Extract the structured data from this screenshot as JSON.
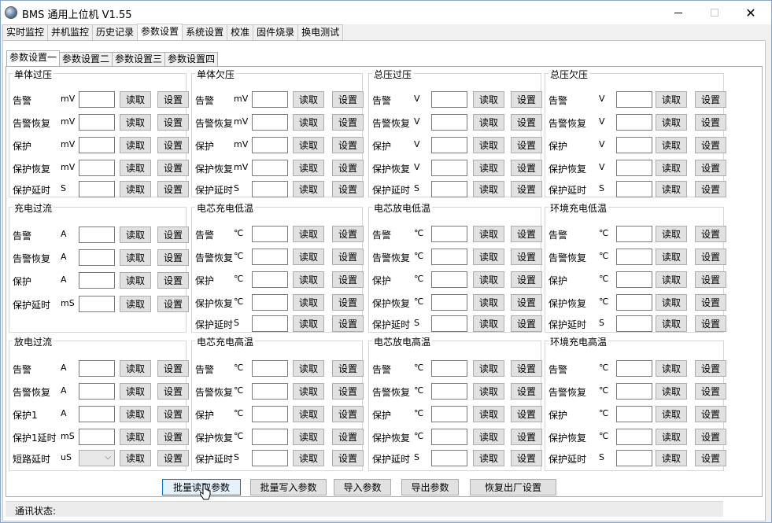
{
  "title": "BMS 通用上位机 V1.55",
  "window_buttons": {
    "minimize": "—",
    "maximize": "",
    "close": "✕"
  },
  "main_tabs": [
    "实时监控",
    "并机监控",
    "历史记录",
    "参数设置",
    "系统设置",
    "校准",
    "固件烧录",
    "换电测试"
  ],
  "main_tab_active": "参数设置",
  "sub_tabs": [
    "参数设置一",
    "参数设置二",
    "参数设置三",
    "参数设置四"
  ],
  "sub_tab_active": "参数设置一",
  "read_label": "读取",
  "set_label": "设置",
  "groups": [
    {
      "title": "单体过压",
      "rows": [
        {
          "label": "告警",
          "unit": "mV"
        },
        {
          "label": "告警恢复",
          "unit": "mV"
        },
        {
          "label": "保护",
          "unit": "mV"
        },
        {
          "label": "保护恢复",
          "unit": "mV"
        },
        {
          "label": "保护延时",
          "unit": "S"
        }
      ]
    },
    {
      "title": "单体欠压",
      "rows": [
        {
          "label": "告警",
          "unit": "mV"
        },
        {
          "label": "告警恢复",
          "unit": "mV"
        },
        {
          "label": "保护",
          "unit": "mV"
        },
        {
          "label": "保护恢复",
          "unit": "mV"
        },
        {
          "label": "保护延时",
          "unit": "S"
        }
      ]
    },
    {
      "title": "总压过压",
      "rows": [
        {
          "label": "告警",
          "unit": "V"
        },
        {
          "label": "告警恢复",
          "unit": "V"
        },
        {
          "label": "保护",
          "unit": "V"
        },
        {
          "label": "保护恢复",
          "unit": "V"
        },
        {
          "label": "保护延时",
          "unit": "S"
        }
      ]
    },
    {
      "title": "总压欠压",
      "rows": [
        {
          "label": "告警",
          "unit": "V"
        },
        {
          "label": "告警恢复",
          "unit": "V"
        },
        {
          "label": "保护",
          "unit": "V"
        },
        {
          "label": "保护恢复",
          "unit": "V"
        },
        {
          "label": "保护延时",
          "unit": "S"
        }
      ]
    },
    {
      "title": "充电过流",
      "rows": [
        {
          "label": "告警",
          "unit": "A"
        },
        {
          "label": "告警恢复",
          "unit": "A"
        },
        {
          "label": "保护",
          "unit": "A"
        },
        {
          "label": "保护延时",
          "unit": "mS"
        }
      ]
    },
    {
      "title": "电芯充电低温",
      "rows": [
        {
          "label": "告警",
          "unit": "℃"
        },
        {
          "label": "告警恢复",
          "unit": "℃"
        },
        {
          "label": "保护",
          "unit": "℃"
        },
        {
          "label": "保护恢复",
          "unit": "℃"
        },
        {
          "label": "保护延时",
          "unit": "S"
        }
      ]
    },
    {
      "title": "电芯放电低温",
      "rows": [
        {
          "label": "告警",
          "unit": "℃"
        },
        {
          "label": "告警恢复",
          "unit": "℃"
        },
        {
          "label": "保护",
          "unit": "℃"
        },
        {
          "label": "保护恢复",
          "unit": "℃"
        },
        {
          "label": "保护延时",
          "unit": "S"
        }
      ]
    },
    {
      "title": "环境充电低温",
      "rows": [
        {
          "label": "告警",
          "unit": "℃"
        },
        {
          "label": "告警恢复",
          "unit": "℃"
        },
        {
          "label": "保护",
          "unit": "℃"
        },
        {
          "label": "保护恢复",
          "unit": "℃"
        },
        {
          "label": "保护延时",
          "unit": "S"
        }
      ]
    },
    {
      "title": "放电过流",
      "rows": [
        {
          "label": "告警",
          "unit": "A"
        },
        {
          "label": "告警恢复",
          "unit": "A"
        },
        {
          "label": "保护1",
          "unit": "A"
        },
        {
          "label": "保护1延时",
          "unit": "mS"
        },
        {
          "label": "短路延时",
          "unit": "uS"
        }
      ]
    },
    {
      "title": "电芯充电高温",
      "rows": [
        {
          "label": "告警",
          "unit": "℃"
        },
        {
          "label": "告警恢复",
          "unit": "℃"
        },
        {
          "label": "保护",
          "unit": "℃"
        },
        {
          "label": "保护恢复",
          "unit": "℃"
        },
        {
          "label": "保护延时",
          "unit": "S"
        }
      ]
    },
    {
      "title": "电芯放电高温",
      "rows": [
        {
          "label": "告警",
          "unit": "℃"
        },
        {
          "label": "告警恢复",
          "unit": "℃"
        },
        {
          "label": "保护",
          "unit": "℃"
        },
        {
          "label": "保护恢复",
          "unit": "℃"
        },
        {
          "label": "保护延时",
          "unit": "S"
        }
      ]
    },
    {
      "title": "环境充电高温",
      "rows": [
        {
          "label": "告警",
          "unit": "℃"
        },
        {
          "label": "告警恢复",
          "unit": "℃"
        },
        {
          "label": "保护",
          "unit": "℃"
        },
        {
          "label": "保护恢复",
          "unit": "℃"
        },
        {
          "label": "保护延时",
          "unit": "S"
        }
      ]
    }
  ],
  "bottom_buttons": [
    "批量读取参数",
    "批量写入参数",
    "导入参数",
    "导出参数",
    "恢复出厂设置"
  ],
  "status_label": "通讯状态:"
}
